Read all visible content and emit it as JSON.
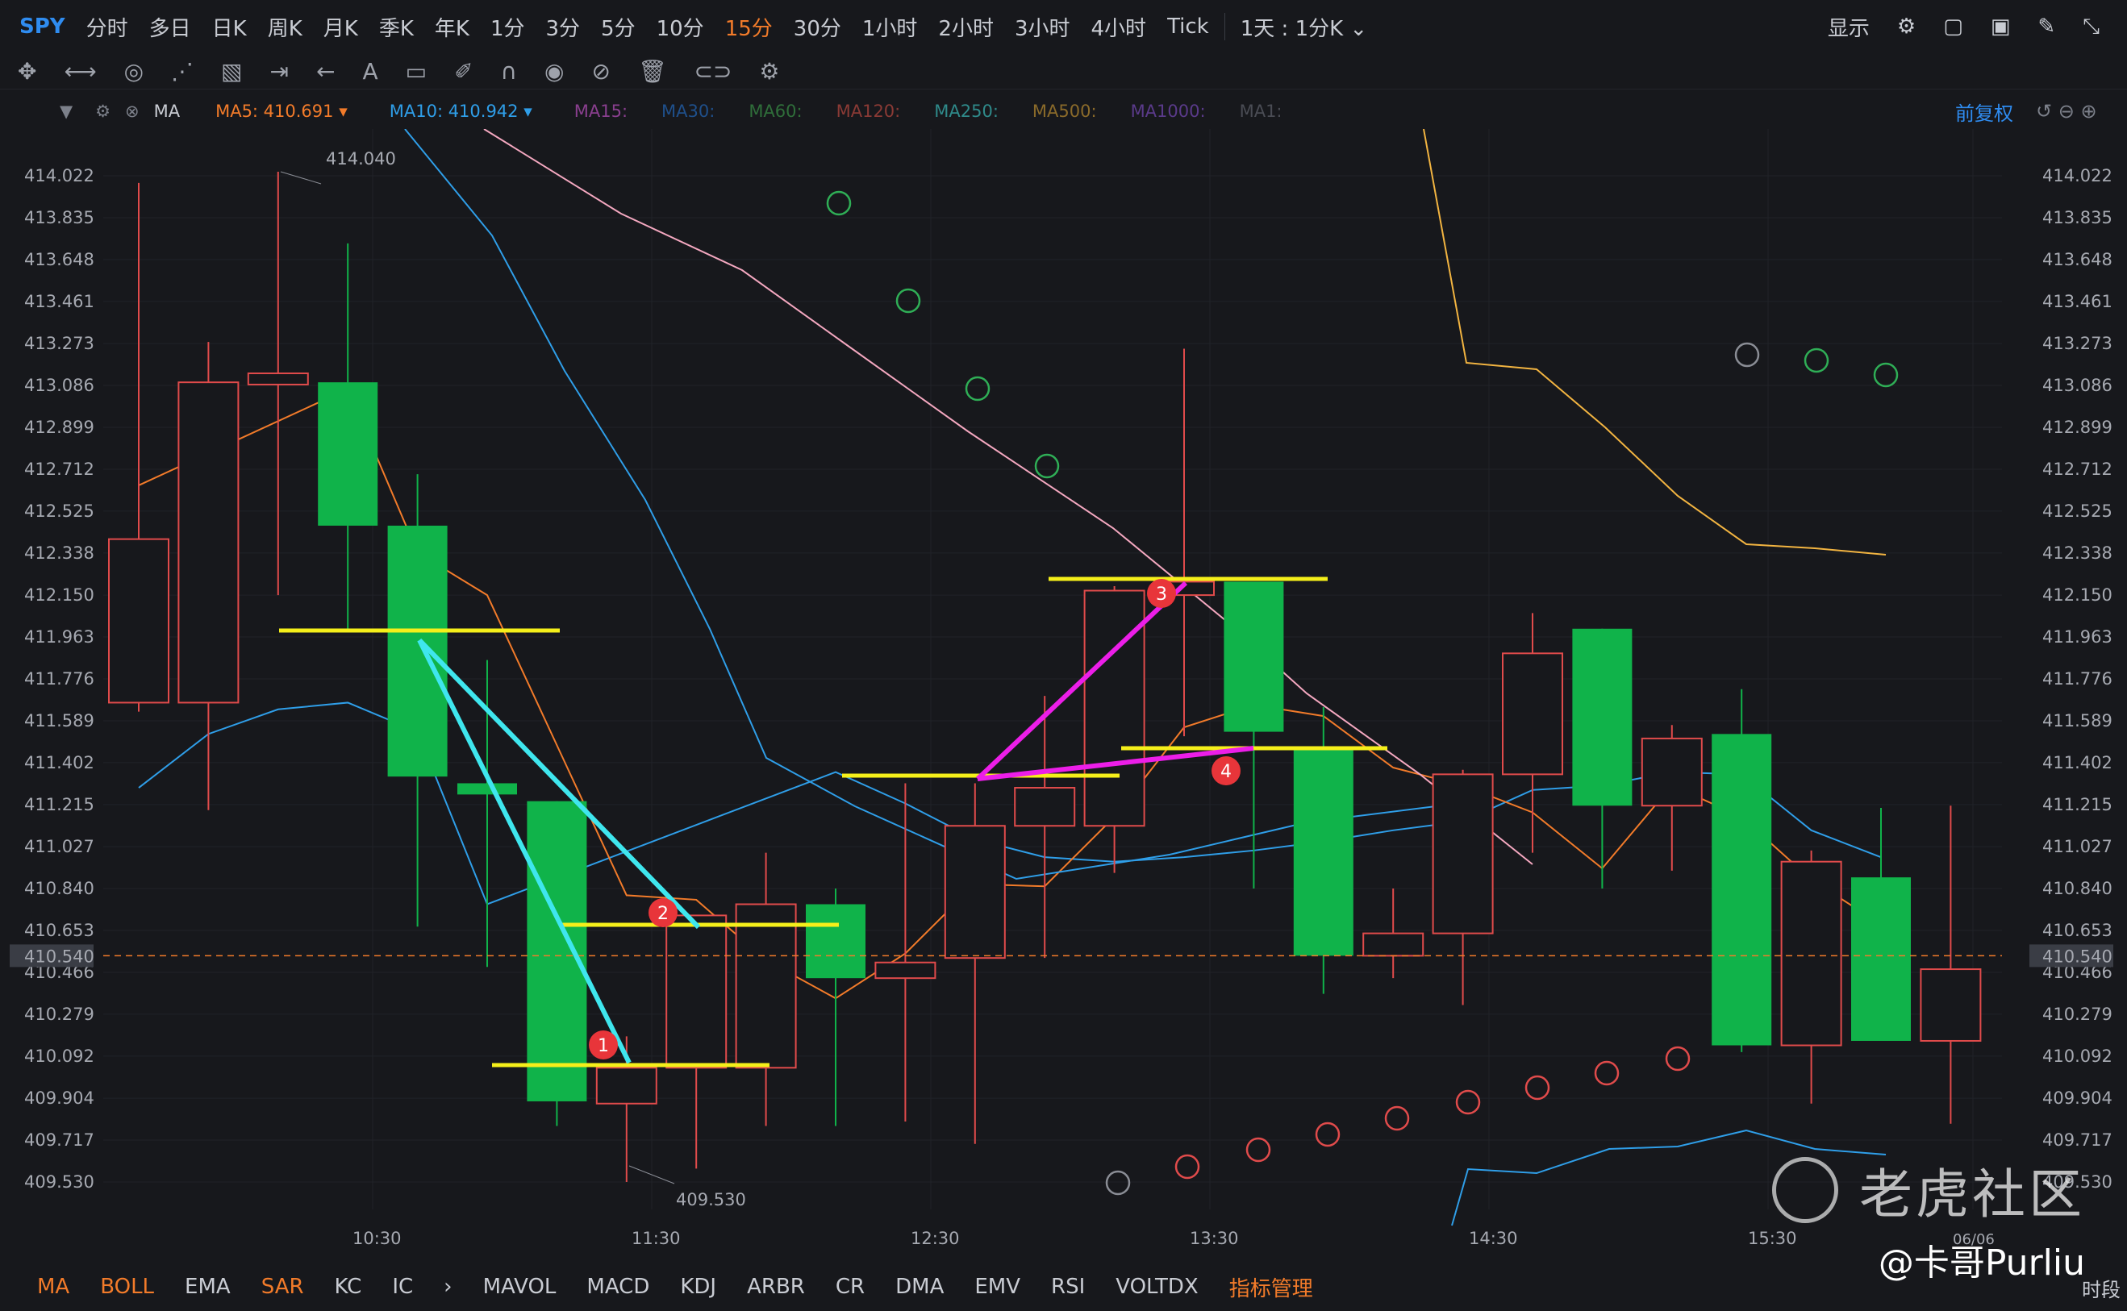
{
  "symbol": "SPY",
  "timeframes": [
    "分时",
    "多日",
    "日K",
    "周K",
    "月K",
    "季K",
    "年K",
    "1分",
    "3分",
    "5分",
    "10分",
    "15分",
    "30分",
    "1小时",
    "2小时",
    "3小时",
    "4小时",
    "Tick"
  ],
  "active_timeframe": "15分",
  "range_selector": "1天 : 1分K",
  "display_label": "显示",
  "ma_bar": {
    "label": "MA",
    "ma5": {
      "label": "MA5:",
      "value": "410.691",
      "color": "#f27b2a"
    },
    "ma10": {
      "label": "MA10:",
      "value": "410.942",
      "color": "#2f9ee8"
    },
    "others": [
      {
        "label": "MA15:",
        "color": "#8a3f8f"
      },
      {
        "label": "MA30:",
        "color": "#1f4f8a"
      },
      {
        "label": "MA60:",
        "color": "#2f6e3a"
      },
      {
        "label": "MA120:",
        "color": "#8a3a35"
      },
      {
        "label": "MA250:",
        "color": "#2f8a8a"
      },
      {
        "label": "MA500:",
        "color": "#8a6a2a"
      },
      {
        "label": "MA1000:",
        "color": "#5a3a8a"
      },
      {
        "label": "MA1:",
        "color": "#4a4c54"
      }
    ],
    "adjust": "前复权"
  },
  "y_axis_ticks": [
    "414.022",
    "413.835",
    "413.648",
    "413.461",
    "413.273",
    "413.086",
    "412.899",
    "412.712",
    "412.525",
    "412.338",
    "412.150",
    "411.963",
    "411.776",
    "411.589",
    "411.402",
    "411.215",
    "411.027",
    "410.840",
    "410.653",
    "410.466",
    "410.279",
    "410.092",
    "409.904",
    "409.717",
    "409.530"
  ],
  "current_price": "410.540",
  "x_axis_labels": [
    "10:30",
    "11:30",
    "12:30",
    "13:30",
    "14:30",
    "15:30",
    "06/06"
  ],
  "annotations": {
    "high": "414.040",
    "low": "409.530",
    "markers": [
      "1",
      "2",
      "3",
      "4"
    ]
  },
  "chart_data": {
    "type": "candlestick",
    "ylim": [
      409.35,
      414.3
    ],
    "candles": [
      {
        "o": 411.67,
        "h": 413.99,
        "l": 411.63,
        "c": 412.4
      },
      {
        "o": 411.67,
        "h": 413.28,
        "l": 411.19,
        "c": 413.1
      },
      {
        "o": 413.09,
        "h": 414.04,
        "l": 412.15,
        "c": 413.14
      },
      {
        "o": 413.1,
        "h": 413.72,
        "l": 411.99,
        "c": 412.46
      },
      {
        "o": 412.46,
        "h": 412.69,
        "l": 410.67,
        "c": 411.34
      },
      {
        "o": 411.31,
        "h": 411.86,
        "l": 410.49,
        "c": 411.26
      },
      {
        "o": 411.23,
        "h": 411.23,
        "l": 409.78,
        "c": 409.89
      },
      {
        "o": 409.88,
        "h": 410.18,
        "l": 409.53,
        "c": 410.04
      },
      {
        "o": 410.04,
        "h": 410.67,
        "l": 409.59,
        "c": 410.72
      },
      {
        "o": 410.04,
        "h": 411.0,
        "l": 409.78,
        "c": 410.77
      },
      {
        "o": 410.77,
        "h": 410.84,
        "l": 409.78,
        "c": 410.44
      },
      {
        "o": 410.44,
        "h": 411.31,
        "l": 409.8,
        "c": 410.51
      },
      {
        "o": 410.53,
        "h": 411.31,
        "l": 409.7,
        "c": 411.12
      },
      {
        "o": 411.12,
        "h": 411.7,
        "l": 410.53,
        "c": 411.29
      },
      {
        "o": 411.12,
        "h": 412.19,
        "l": 410.91,
        "c": 412.17
      },
      {
        "o": 412.15,
        "h": 413.25,
        "l": 411.52,
        "c": 412.21
      },
      {
        "o": 412.21,
        "h": 412.2,
        "l": 410.84,
        "c": 411.54
      },
      {
        "o": 411.46,
        "h": 411.65,
        "l": 410.37,
        "c": 410.54
      },
      {
        "o": 410.54,
        "h": 410.84,
        "l": 410.44,
        "c": 410.64
      },
      {
        "o": 410.64,
        "h": 411.37,
        "l": 410.32,
        "c": 411.35
      },
      {
        "o": 411.35,
        "h": 412.07,
        "l": 411.0,
        "c": 411.89
      },
      {
        "o": 412.0,
        "h": 412.0,
        "l": 410.84,
        "c": 411.21
      },
      {
        "o": 411.21,
        "h": 411.57,
        "l": 410.92,
        "c": 411.51
      },
      {
        "o": 411.53,
        "h": 411.73,
        "l": 410.11,
        "c": 410.14
      },
      {
        "o": 410.14,
        "h": 411.01,
        "l": 409.88,
        "c": 410.96
      },
      {
        "o": 410.89,
        "h": 411.2,
        "l": 410.29,
        "c": 410.16
      },
      {
        "o": 410.16,
        "h": 411.21,
        "l": 409.79,
        "c": 410.48
      }
    ],
    "ma5": [
      412.64,
      null,
      null,
      413.07,
      412.34,
      412.15,
      411.48,
      410.81,
      410.79,
      410.52,
      410.35,
      410.55,
      410.86,
      410.85,
      411.16,
      411.56,
      411.66,
      411.61,
      411.38,
      411.3,
      411.18,
      410.93,
      411.3,
      411.16,
      410.88,
      410.68
    ],
    "ma10": [
      411.29,
      411.53,
      411.64,
      411.67,
      411.54,
      410.77,
      null,
      null,
      null,
      null,
      411.36,
      411.22,
      411.06,
      410.98,
      410.96,
      410.98,
      411.01,
      411.05,
      411.1,
      411.14,
      411.28,
      411.3,
      411.36,
      411.35,
      411.1,
      410.98
    ]
  }
}
